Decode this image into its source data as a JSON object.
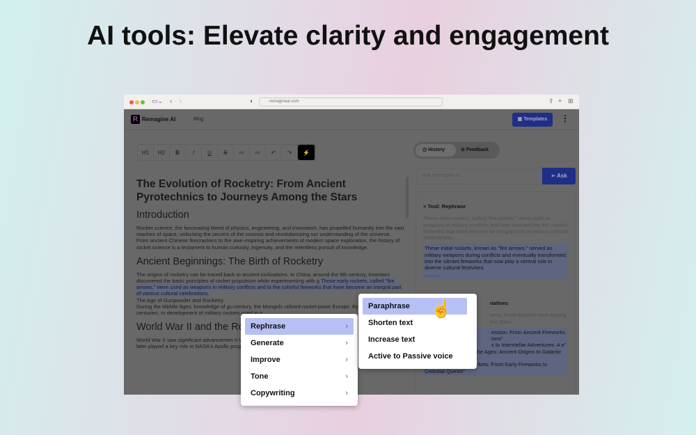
{
  "headline": "AI tools: Elevate clarity and engagement",
  "browser": {
    "url": "remagineai.com"
  },
  "header": {
    "logo_letter": "R",
    "brand": "Remagine AI",
    "blog_label": "Blog:",
    "templates_label": "Templates",
    "more_icon": "kebab-icon"
  },
  "toolbar": [
    "H1",
    "H2",
    "B",
    "I",
    "U",
    "S",
    "≔",
    "≔",
    "↶",
    "↷",
    "⚡"
  ],
  "document": {
    "title": "The Evolution of Rocketry: From Ancient Pyrotechnics to Journeys Among the Stars",
    "intro_heading": "Introduction",
    "intro_text": "Rocket science, the fascinating blend of physics, engineering, and innovation, has propelled humanity into the vast reaches of space, unlocking the secrets of the cosmos and revolutionizing our understanding of the universe. From ancient Chinese firecrackers to the awe-inspiring achievements of modern space exploration, the history of rocket science is a testament to human curiosity, ingenuity, and the relentless pursuit of knowledge.",
    "ancient_heading": "Ancient Beginnings: The Birth of Rocketry",
    "ancient_text_1": "The origins of rocketry can be traced back to ancient civilizations. In China, around the 9th century, inventors discovered the basic principles of rocket propulsion while experimenting with g",
    "ancient_selected": "These early rockets, called \"fire arrows,\" were used as weapons in military conflicts and la the colorful fireworks that have become an integral part of various cultural celebrations.",
    "ancient_text_2": "The Age of Gunpowder and Rocketry",
    "ancient_text_3": "During the Middle Ages, knowledge of gu century, the Mongols utilized rocket-powe Europe. By the 16th and 17th centuries, ro development of military rockets used in n",
    "ww2_heading": "World War II and the Ro",
    "ww2_text": "World War II saw significant advancemen n V-2 rocket, the world's first long-range guided ballistic mi Braun, who later played a key role in NASA's Apollo prograr space exploration efforts. After the war, both the erman scientists"
  },
  "panel": {
    "tabs": [
      {
        "label": "History",
        "icon": "clock-icon"
      },
      {
        "label": "Feedback",
        "icon": "check-circle-icon"
      }
    ],
    "ask_placeholder": "Ask Remagine AI ...",
    "ask_label": "Ask",
    "tool_title": "> Tool: Rephrase",
    "original": "These early rockets, called \"fire arrows,\" were used as weapons in military conflicts and later evolved into the colorful fireworks that have become an integral part of various cultural celebrations.",
    "rephrased": "These initial rockets, known as \"fire arrows,\" served as military weapons during conflicts and eventually transformed into the vibrant fireworks that now play a central role in diverse cultural festivities.",
    "ellipsis": "..........",
    "tool2_title": "natives",
    "original2": "ketry: From Ancient neys Among the Stars",
    "alternatives": [
      "ession: From Ancient Fireworks ions\"",
      "s to Interstellar Adventures: A e\"",
      "3. \"Rocketry Through the Ages: Ancient Origins to Galactic Voyages\"",
      "4. \"The Journey of Rockets: From Early Fireworks to Celestial Quests\""
    ]
  },
  "menu": [
    "Rephrase",
    "Generate",
    "Improve",
    "Tone",
    "Copywriting"
  ],
  "submenu": [
    "Paraphrase",
    "Shorten text",
    "Increase text",
    "Active to Passive voice"
  ]
}
